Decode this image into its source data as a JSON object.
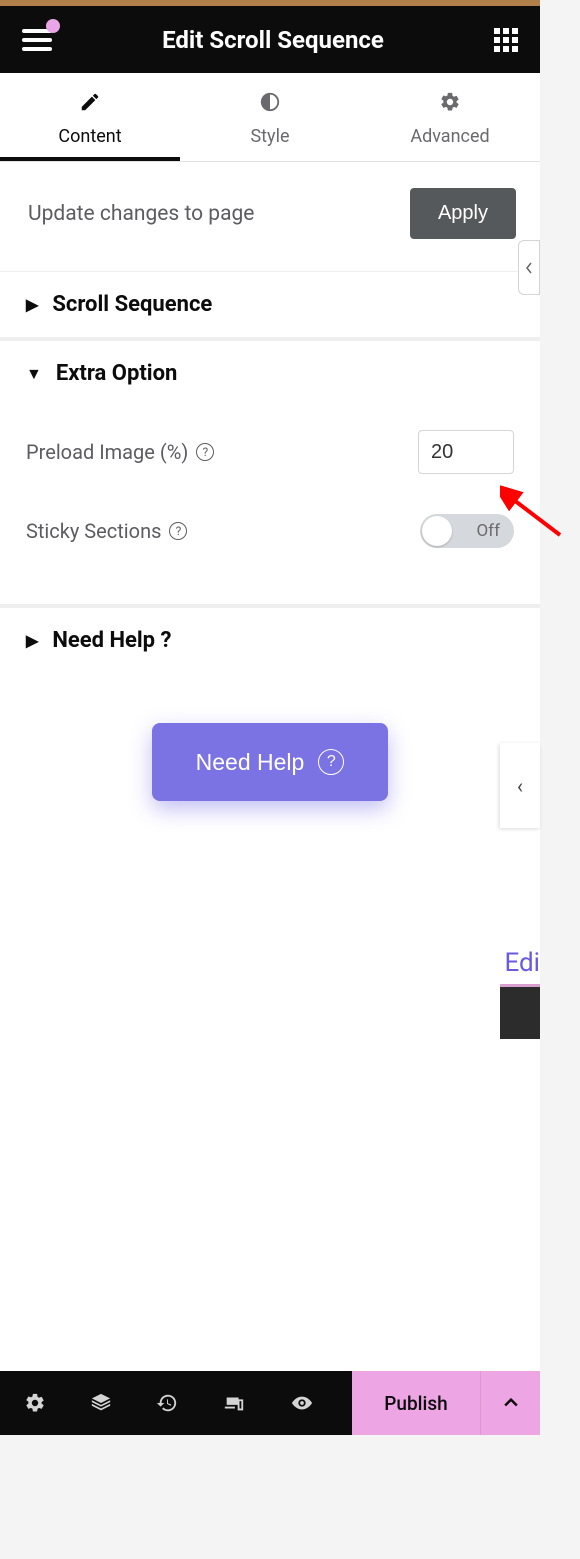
{
  "header": {
    "title": "Edit Scroll Sequence"
  },
  "tabs": {
    "content": "Content",
    "style": "Style",
    "advanced": "Advanced",
    "active": "content"
  },
  "apply": {
    "text": "Update changes to page",
    "button": "Apply"
  },
  "sections": {
    "scroll_sequence": {
      "title": "Scroll Sequence",
      "expanded": false
    },
    "extra_option": {
      "title": "Extra Option",
      "expanded": true,
      "preload_label": "Preload Image (%)",
      "preload_value": "20",
      "sticky_label": "Sticky Sections",
      "sticky_off": "Off",
      "sticky_on": false
    },
    "need_help": {
      "title": "Need Help ?",
      "expanded": false
    }
  },
  "need_help_button": "Need Help",
  "footer": {
    "publish": "Publish"
  },
  "side": {
    "edi": "Edi"
  }
}
